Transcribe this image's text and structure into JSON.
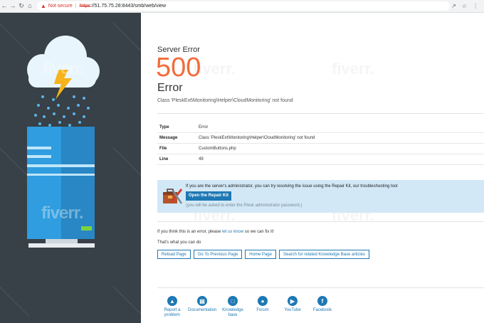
{
  "browser": {
    "back_icon": "arrow-left-icon",
    "forward_icon": "arrow-right-icon",
    "reload_icon": "reload-icon",
    "home_icon": "home-icon",
    "warning_text": "Not secure",
    "url_scheme": "https",
    "url_rest": "://51.75.75.28:8443/smb/web/view"
  },
  "error": {
    "heading": "Server Error",
    "code": "500",
    "title": "Error",
    "message": "Class 'PleskExt\\Monitoring\\Helper\\CloudMonitoring' not found"
  },
  "details": [
    {
      "key": "Type",
      "value": "Error"
    },
    {
      "key": "Message",
      "value": "Class 'PleskExt\\Monitoring\\Helper\\CloudMonitoring' not found"
    },
    {
      "key": "File",
      "value": "CustomButtons.php"
    },
    {
      "key": "Line",
      "value": "49"
    }
  ],
  "repair": {
    "text": "If you are the server's administrator, you can try resolving the issue using the Repair Kit, our troubleshooting tool",
    "button": "Open the Repair Kit",
    "note": "(you will be asked to enter the Plesk administrator password.)"
  },
  "help": {
    "if_prefix": "If you think this is an error, please",
    "link": "let us know",
    "if_suffix": "so we can fix it!",
    "can_do": "That's what you can do"
  },
  "actions": [
    "Reload Page",
    "Go To Previous Page",
    "Home Page",
    "Search for related Knowledge Base articles"
  ],
  "footer": [
    {
      "label": "Report a problem",
      "icon": "warning-icon"
    },
    {
      "label": "Documentation",
      "icon": "document-icon"
    },
    {
      "label": "Knowledge base",
      "icon": "book-icon"
    },
    {
      "label": "Forum",
      "icon": "chat-icon"
    },
    {
      "label": "YouTube",
      "icon": "youtube-icon"
    },
    {
      "label": "Facebook",
      "icon": "facebook-icon"
    }
  ],
  "colors": {
    "accent": "#1e78b4",
    "error_code": "#f26c3a",
    "left_panel": "#384048",
    "repair_bg": "#d2e8f7"
  }
}
